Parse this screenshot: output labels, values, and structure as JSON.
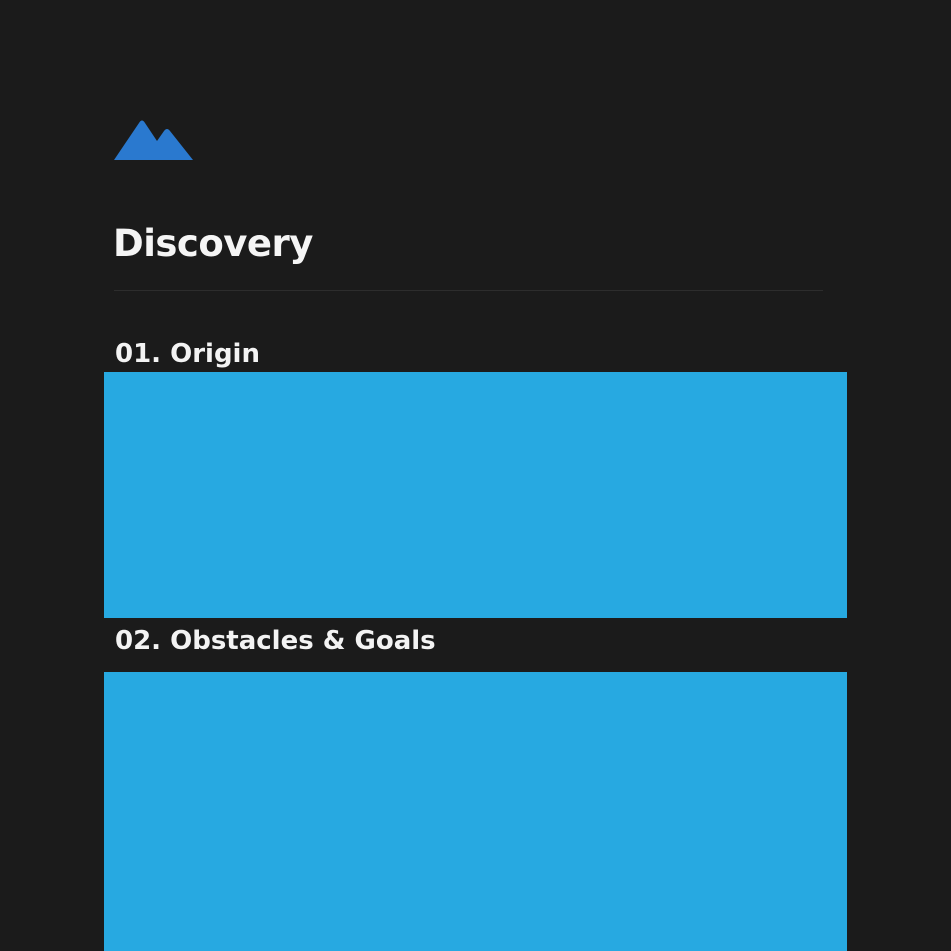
{
  "logo": {
    "icon": "mountain-icon",
    "color": "#2a79cf"
  },
  "page": {
    "title": "Discovery"
  },
  "sections": [
    {
      "heading": "01. Origin",
      "block_color": "#27a9e1"
    },
    {
      "heading": "02. Obstacles & Goals",
      "block_color": "#27a9e1"
    }
  ],
  "colors": {
    "background": "#1b1b1b",
    "text": "#f3f3f3",
    "divider": "#2d2d2d"
  }
}
